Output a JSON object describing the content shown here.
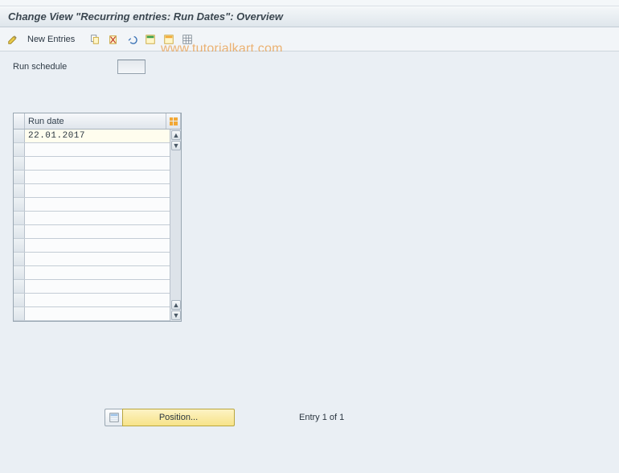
{
  "title": "Change View \"Recurring entries: Run Dates\": Overview",
  "watermark": "www.tutorialkart.com",
  "toolbar": {
    "new_entries_label": "New Entries"
  },
  "fields": {
    "run_schedule_label": "Run schedule",
    "run_schedule_value": ""
  },
  "table": {
    "column_header": "Run date",
    "rows": [
      "22.01.2017",
      "",
      "",
      "",
      "",
      "",
      "",
      "",
      "",
      "",
      "",
      "",
      "",
      ""
    ]
  },
  "footer": {
    "position_label": "Position...",
    "entry_status": "Entry 1 of 1"
  }
}
